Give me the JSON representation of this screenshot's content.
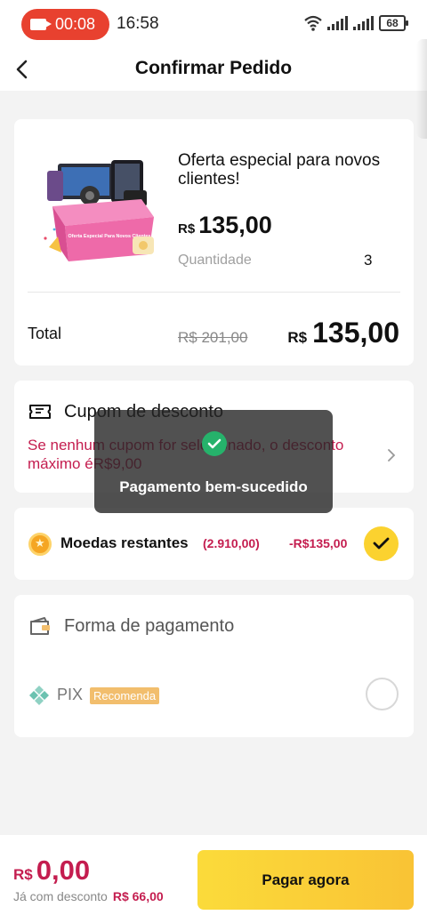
{
  "status_bar": {
    "record_time": "00:08",
    "clock": "16:58",
    "battery": "68",
    "icons": [
      "record-icon",
      "wifi-icon",
      "signal-icon",
      "signal-icon",
      "battery-icon"
    ]
  },
  "header": {
    "title": "Confirmar Pedido",
    "back_icon": "chevron-left-icon"
  },
  "product": {
    "image_icon": "electronics-bundle-gift-box",
    "box_text": "Oferta Especial Para Novos Clientes",
    "title": "Oferta especial para novos clientes!",
    "currency": "R$",
    "price": "135,00",
    "quantity_label": "Quantidade",
    "quantity": "3"
  },
  "total": {
    "label": "Total",
    "original_price": "R$ 201,00",
    "currency": "R$",
    "amount": "135,00"
  },
  "coupon": {
    "title": "Cupom de desconto",
    "description": "Se nenhum cupom for selecionado, o desconto máximo éR$9,00",
    "icon": "ticket-icon"
  },
  "coins": {
    "label": "Moedas restantes",
    "balance": "(2.910,00)",
    "discount": "-R$135,00",
    "checked": true
  },
  "payment": {
    "title": "Forma de pagamento",
    "method": "PIX",
    "badge": "Recomenda",
    "selected": false
  },
  "toast": {
    "message": "Pagamento bem-sucedido"
  },
  "bottom_bar": {
    "currency": "R$",
    "amount": "0,00",
    "saved_label": "Já com desconto",
    "saved_value": "R$ 66,00",
    "pay_button": "Pagar agora"
  },
  "colors": {
    "accent_red": "#c41d4f",
    "button_yellow": "#fbd22f",
    "record_red": "#e8412f",
    "success_green": "#26b26b"
  }
}
